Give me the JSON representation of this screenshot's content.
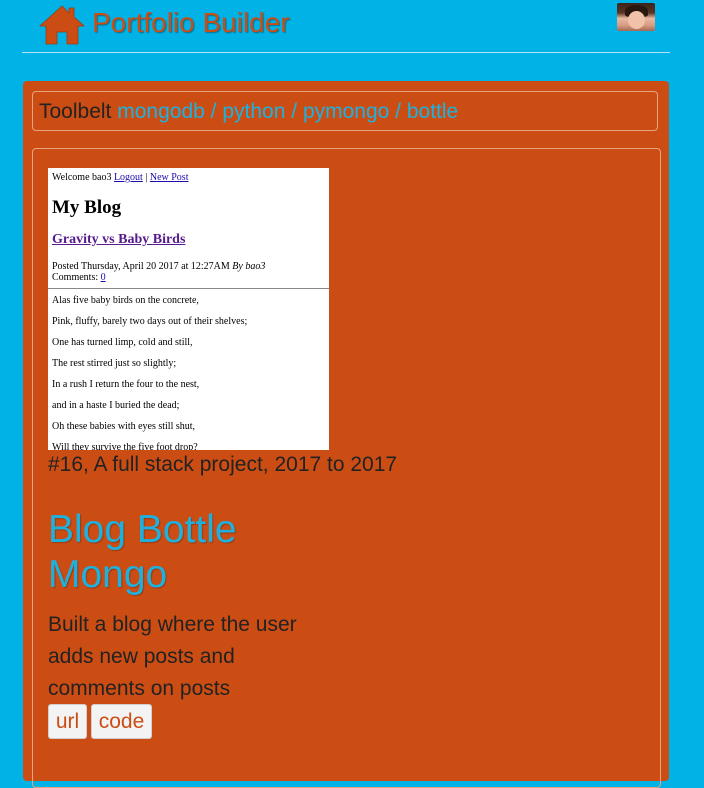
{
  "header": {
    "brand": "Portfolio Builder"
  },
  "toolbelt": {
    "label": "Toolbelt",
    "items": [
      "mongodb",
      "python",
      "pymongo",
      "bottle"
    ],
    "separator": "/"
  },
  "project": {
    "screenshot": {
      "welcome_prefix": "Welcome bao3",
      "logout": "Logout",
      "sep": "|",
      "new_post": "New Post",
      "blog_title": "My Blog",
      "post_title": "Gravity vs Baby Birds",
      "posted": "Posted Thursday, April 20 2017 at 12:27AM",
      "by": "By bao3",
      "comments_label": "Comments:",
      "comments_count": "0",
      "lines": [
        "Alas five baby birds on the concrete,",
        "Pink, fluffy, barely two days out of their shelves;",
        "One has turned limp, cold and still,",
        "The rest stirred just so slightly;",
        "In a rush I return the four to the nest,",
        "and in a haste I buried the dead;",
        "Oh these babies with eyes still shut,",
        "Will they survive the five foot drop?"
      ]
    },
    "caption": "#16, A full stack project, 2017 to 2017",
    "title": "Blog Bottle Mongo",
    "description": "Built a blog where the user adds new posts and comments on posts",
    "buttons": {
      "url": "url",
      "code": "code"
    }
  }
}
